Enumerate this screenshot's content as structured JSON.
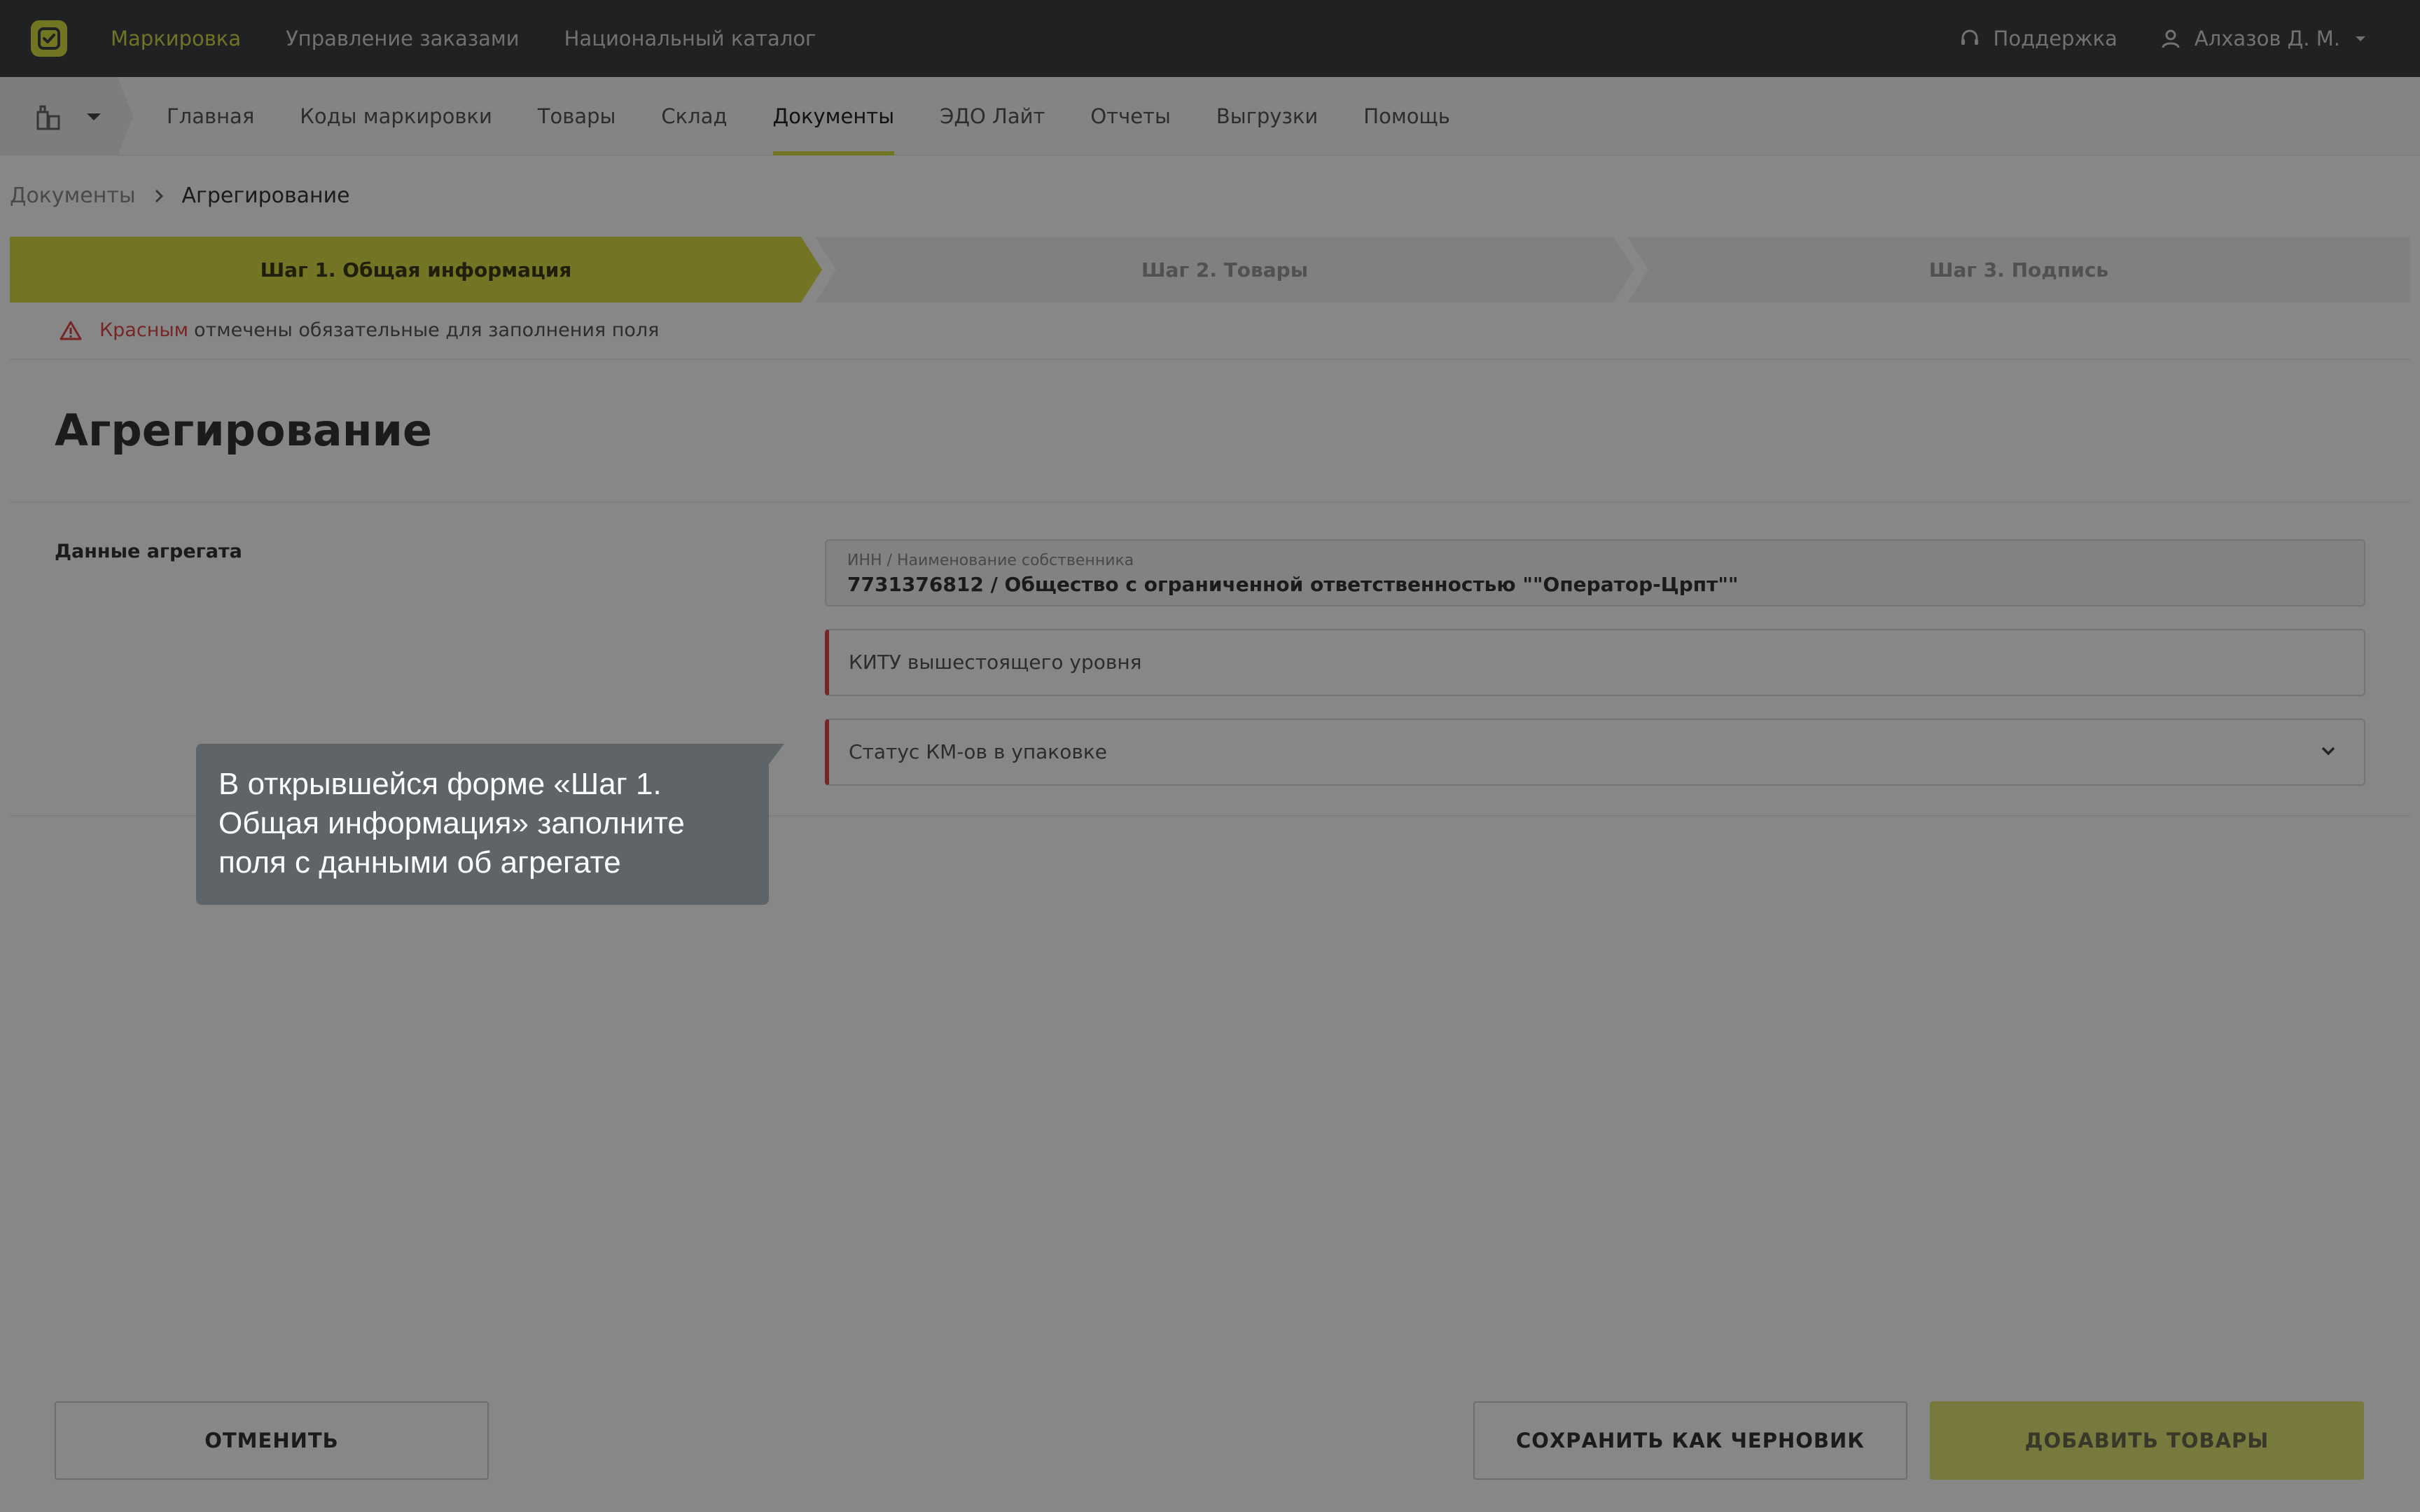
{
  "topbar": {
    "logo_icon": "check-square-icon",
    "nav": [
      {
        "label": "Маркировка",
        "active": true
      },
      {
        "label": "Управление заказами",
        "active": false
      },
      {
        "label": "Национальный каталог",
        "active": false
      }
    ],
    "support_label": "Поддержка",
    "user_label": "Алхазов Д. М.",
    "accent_color": "#d8dd3f",
    "bar_color": "#3d3f43"
  },
  "subnav": {
    "selector_icon": "product-group-icon",
    "items": [
      {
        "label": "Главная",
        "active": false
      },
      {
        "label": "Коды маркировки",
        "active": false
      },
      {
        "label": "Товары",
        "active": false
      },
      {
        "label": "Склад",
        "active": false
      },
      {
        "label": "Документы",
        "active": true
      },
      {
        "label": "ЭДО Лайт",
        "active": false
      },
      {
        "label": "Отчеты",
        "active": false
      },
      {
        "label": "Выгрузки",
        "active": false
      },
      {
        "label": "Помощь",
        "active": false
      }
    ]
  },
  "breadcrumb": {
    "parent": "Документы",
    "current": "Агрегирование"
  },
  "stepper": {
    "steps": [
      {
        "label": "Шаг 1. Общая информация",
        "active": true
      },
      {
        "label": "Шаг 2. Товары",
        "active": false
      },
      {
        "label": "Шаг 3. Подпись",
        "active": false
      }
    ]
  },
  "notice": {
    "highlight": "Красным",
    "text": "отмечены обязательные для заполнения поля",
    "color": "#e04646"
  },
  "form": {
    "title": "Агрегирование",
    "section_label": "Данные агрегата",
    "owner": {
      "label": "ИНН / Наименование собственника",
      "value": "7731376812 / Общество с ограниченной ответственностью \"\"Оператор-Црпт\"\""
    },
    "kitu": {
      "placeholder": "КИТУ вышестоящего уровня"
    },
    "status": {
      "placeholder": "Статус КМ-ов в упаковке"
    }
  },
  "footer": {
    "cancel": "ОТМЕНИТЬ",
    "save_draft": "СОХРАНИТЬ КАК ЧЕРНОВИК",
    "add_goods": "ДОБАВИТЬ ТОВАРЫ"
  },
  "tooltip": {
    "text": "В открывшейся форме «Шаг 1. Общая информация» заполните поля с данными об агрегате"
  }
}
